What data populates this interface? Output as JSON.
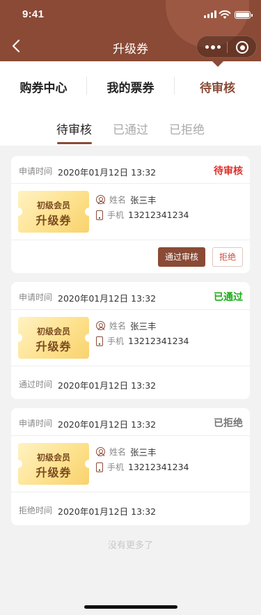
{
  "status_bar": {
    "time": "9:41"
  },
  "nav": {
    "title": "升级券"
  },
  "top_tabs": [
    {
      "label": "购券中心",
      "active": false
    },
    {
      "label": "我的票券",
      "active": false
    },
    {
      "label": "待审核",
      "active": true
    }
  ],
  "sub_tabs": [
    {
      "label": "待审核",
      "active": true
    },
    {
      "label": "已通过",
      "active": false
    },
    {
      "label": "已拒绝",
      "active": false
    }
  ],
  "labels": {
    "apply_time": "申请时间",
    "name": "姓名",
    "phone": "手机",
    "pass_time": "通过时间",
    "reject_time": "拒绝时间",
    "btn_pass": "通过审核",
    "btn_reject": "拒绝"
  },
  "colors": {
    "brand": "#8a4a36",
    "pending": "#e0302a",
    "passed": "#1aad19",
    "rejected": "#777777"
  },
  "cards": [
    {
      "apply_time": "2020年01月12日 13:32",
      "status": "待审核",
      "coupon_line1": "初级会员",
      "coupon_line2": "升级券",
      "name": "张三丰",
      "phone": "13212341234"
    },
    {
      "apply_time": "2020年01月12日 13:32",
      "status": "已通过",
      "coupon_line1": "初级会员",
      "coupon_line2": "升级券",
      "name": "张三丰",
      "phone": "13212341234",
      "result_time": "2020年01月12日 13:32"
    },
    {
      "apply_time": "2020年01月12日 13:32",
      "status": "已拒绝",
      "coupon_line1": "初级会员",
      "coupon_line2": "升级券",
      "name": "张三丰",
      "phone": "13212341234",
      "result_time": "2020年01月12日 13:32"
    }
  ],
  "footer": {
    "no_more": "没有更多了"
  }
}
